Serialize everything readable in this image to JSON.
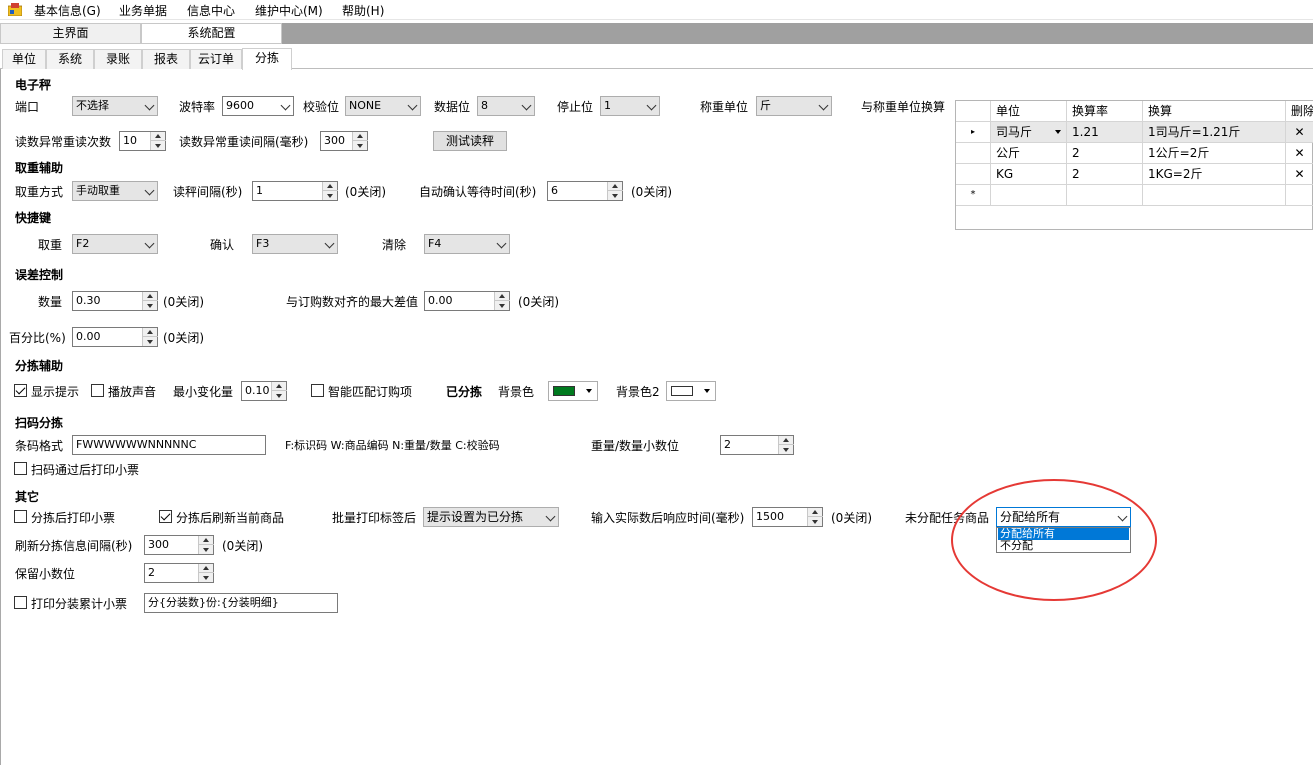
{
  "menubar": {
    "items": [
      "基本信息(G)",
      "业务单据",
      "信息中心",
      "维护中心(M)",
      "帮助(H)"
    ]
  },
  "doc_tabs": [
    "主界面",
    "系统配置"
  ],
  "config_tabs": [
    "单位",
    "系统",
    "录账",
    "报表",
    "云订单",
    "分拣"
  ],
  "scale": {
    "header": "电子秤",
    "port_label": "端口",
    "port_value": "不选择",
    "baud_label": "波特率",
    "baud_value": "9600",
    "parity_label": "校验位",
    "parity_value": "NONE",
    "databits_label": "数据位",
    "databits_value": "8",
    "stopbits_label": "停止位",
    "stopbits_value": "1",
    "unit_label": "称重单位",
    "unit_value": "斤",
    "conv_label": "与称重单位换算",
    "retry_count_label": "读数异常重读次数",
    "retry_count_value": "10",
    "retry_interval_label": "读数异常重读间隔(毫秒)",
    "retry_interval_value": "300",
    "test_button": "测试读秤"
  },
  "conversion_grid": {
    "headers": [
      "单位",
      "换算率",
      "换算",
      "删除"
    ],
    "rows": [
      {
        "unit": "司马斤",
        "rate": "1.21",
        "calc": "1司马斤=1.21斤",
        "delete": "✕"
      },
      {
        "unit": "公斤",
        "rate": "2",
        "calc": "1公斤=2斤",
        "delete": "✕"
      },
      {
        "unit": "KG",
        "rate": "2",
        "calc": "1KG=2斤",
        "delete": "✕"
      }
    ],
    "new_row_marker": "*",
    "current_row_marker": "▸"
  },
  "weigh_assist": {
    "header": "取重辅助",
    "mode_label": "取重方式",
    "mode_value": "手动取重",
    "interval_label": "读秤间隔(秒)",
    "interval_value": "1",
    "interval_note": "(0关闭)",
    "confirm_label": "自动确认等待时间(秒)",
    "confirm_value": "6",
    "confirm_note": "(0关闭)"
  },
  "hotkeys": {
    "header": "快捷键",
    "take_label": "取重",
    "take_value": "F2",
    "confirm_label": "确认",
    "confirm_value": "F3",
    "clear_label": "清除",
    "clear_value": "F4"
  },
  "error_control": {
    "header": "误差控制",
    "qty_label": "数量",
    "qty_value": "0.30",
    "qty_note": "(0关闭)",
    "max_diff_label": "与订购数对齐的最大差值",
    "max_diff_value": "0.00",
    "max_diff_note": "(0关闭)",
    "percent_label": "百分比(%)",
    "percent_value": "0.00",
    "percent_note": "(0关闭)"
  },
  "sort_assist": {
    "header": "分拣辅助",
    "show_hint": "显示提示",
    "play_sound": "播放声音",
    "min_change_label": "最小变化量",
    "min_change_value": "0.10",
    "smart_match": "智能匹配订购项",
    "sorted_label": "已分拣",
    "bg_label": "背景色",
    "bg_color": "#007a1f",
    "bg2_label": "背景色2",
    "bg2_color": "#ffffff"
  },
  "scan_sort": {
    "header": "扫码分拣",
    "format_label": "条码格式",
    "format_value": "FWWWWWWNNNNNC",
    "legend": "F:标识码  W:商品编码  N:重量/数量  C:校验码",
    "decimals_label": "重量/数量小数位",
    "decimals_value": "2",
    "print_after_scan": "扫码通过后打印小票"
  },
  "other": {
    "header": "其它",
    "print_after_sort": "分拣后打印小票",
    "refresh_after_sort": "分拣后刷新当前商品",
    "batch_print_label": "批量打印标签后",
    "batch_print_value": "提示设置为已分拣",
    "response_label": "输入实际数后响应时间(毫秒)",
    "response_value": "1500",
    "response_note": "(0关闭)",
    "unassigned_label": "未分配任务商品",
    "unassigned_value": "分配给所有",
    "unassigned_options": [
      "分配给所有",
      "不分配"
    ],
    "refresh_interval_label": "刷新分拣信息间隔(秒)",
    "refresh_interval_value": "300",
    "refresh_interval_note": "(0关闭)",
    "decimals_label": "保留小数位",
    "decimals_value": "2",
    "print_cumulative": "打印分装累计小票",
    "template_value": "分{分装数}份:{分装明细}"
  }
}
